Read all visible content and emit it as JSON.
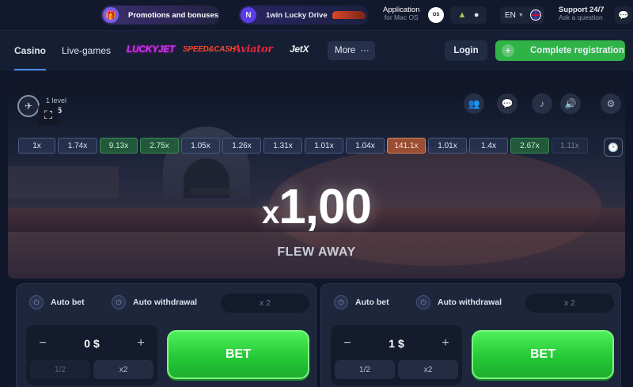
{
  "topbar": {
    "promo_label": "Promotions and bonuses",
    "lucky_drive_label": "1win Lucky Drive",
    "lucky_drive_badge": "N",
    "app_line1": "Application",
    "app_line2": "for Mac OS",
    "os_badge": "OS",
    "lang": "EN",
    "support_line1": "Support 24/7",
    "support_line2": "Ask a question"
  },
  "nav": {
    "casino": "Casino",
    "live_games": "Live-games",
    "brands": [
      "LUCKYJET",
      "SPEED&CASH",
      "Aviator",
      "JetX"
    ],
    "more": "More",
    "login": "Login",
    "register": "Complete registration"
  },
  "game": {
    "level_label": "1 level",
    "level_value": "5",
    "history": [
      {
        "value": "1x",
        "tone": "blue"
      },
      {
        "value": "1.74x",
        "tone": "blue"
      },
      {
        "value": "9.13x",
        "tone": "green"
      },
      {
        "value": "2.75x",
        "tone": "green"
      },
      {
        "value": "1.05x",
        "tone": "blue"
      },
      {
        "value": "1.26x",
        "tone": "blue"
      },
      {
        "value": "1.31x",
        "tone": "blue"
      },
      {
        "value": "1.01x",
        "tone": "blue"
      },
      {
        "value": "1.04x",
        "tone": "blue"
      },
      {
        "value": "141.1x",
        "tone": "orange"
      },
      {
        "value": "1.01x",
        "tone": "blue"
      },
      {
        "value": "1.4x",
        "tone": "blue"
      },
      {
        "value": "2.67x",
        "tone": "green"
      },
      {
        "value": "1.11x",
        "tone": "faded"
      }
    ],
    "multiplier_prefix": "x",
    "multiplier": "1,00",
    "status": "FLEW AWAY"
  },
  "bet_panels": [
    {
      "auto_bet": "Auto bet",
      "auto_withdrawal": "Auto withdrawal",
      "cashout_placeholder": "x 2",
      "amount": "0 $",
      "half": "1/2",
      "double": "x2",
      "bet": "BET"
    },
    {
      "auto_bet": "Auto bet",
      "auto_withdrawal": "Auto withdrawal",
      "cashout_placeholder": "x 2",
      "amount": "1 $",
      "half": "1/2",
      "double": "x2",
      "bet": "BET"
    }
  ],
  "colors": {
    "accent_green": "#2fb347",
    "bet_green": "#25c936",
    "history_orange": "#a05032"
  }
}
